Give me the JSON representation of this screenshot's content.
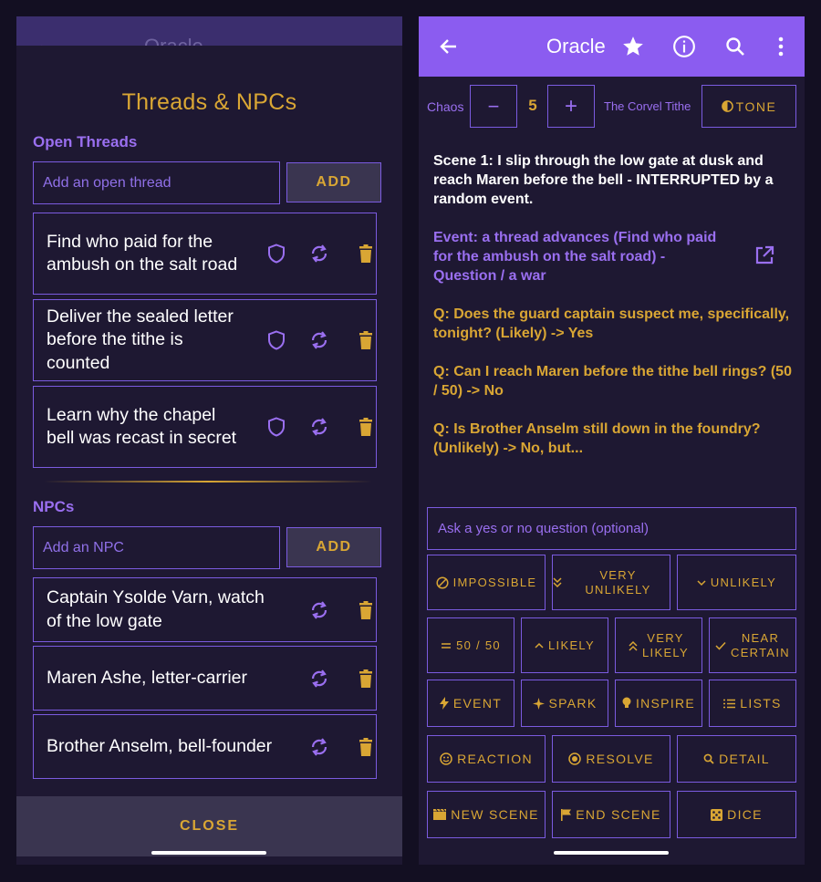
{
  "left": {
    "background_appbar": {
      "title": "Oracle"
    },
    "dialog": {
      "title": "Threads & NPCs",
      "threads_label": "Open Threads",
      "thread_input_placeholder": "Add an open thread",
      "add_label": "ADD",
      "threads": [
        {
          "text": "Find who paid for the ambush on the salt road"
        },
        {
          "text": "Deliver the sealed letter before the tithe is counted"
        },
        {
          "text": "Learn why the chapel bell was recast in secret"
        }
      ],
      "npcs_label": "NPCs",
      "npc_input_placeholder": "Add an NPC",
      "npcs": [
        {
          "text": "Captain Ysolde Varn, watch of the low gate"
        },
        {
          "text": "Maren Ashe, letter-carrier"
        },
        {
          "text": "Brother Anselm, bell-founder"
        }
      ],
      "close_label": "CLOSE"
    }
  },
  "right": {
    "appbar": {
      "title": "Oracle"
    },
    "chaos": {
      "label": "Chaos",
      "value": "5",
      "minus": "−",
      "plus": "+"
    },
    "theme_label": "The Corvel Tithe",
    "tone_label": "TONE",
    "log": {
      "scene": "Scene 1: I slip through the low gate at dusk and reach Maren before the bell - INTERRUPTED by a random event.",
      "event": "Event: a thread advances (Find who paid for the ambush on the salt road) - Question / a war",
      "questions": [
        "Q: Does the guard captain suspect me, specifically, tonight? (Likely) -> Yes",
        "Q: Can I reach Maren before the tithe bell rings? (50 / 50) -> No",
        "Q: Is Brother Anselm still down in the foundry? (Unlikely) -> No, but..."
      ]
    },
    "ask_placeholder": "Ask a yes or no question (optional)",
    "odds": {
      "impossible": "IMPOSSIBLE",
      "very_unlikely": "VERY UNLIKELY",
      "unlikely": "UNLIKELY",
      "fifty": "50 / 50",
      "likely": "LIKELY",
      "very_likely_1": "VERY",
      "very_likely_2": "LIKELY",
      "near_certain_1": "NEAR",
      "near_certain_2": "CERTAIN"
    },
    "actions": {
      "event": "EVENT",
      "spark": "SPARK",
      "inspire": "INSPIRE",
      "lists": "LISTS",
      "reaction": "REACTION",
      "resolve": "RESOLVE",
      "detail": "DETAIL",
      "new_scene": "NEW SCENE",
      "end_scene": "END SCENE",
      "dice": "DICE"
    }
  },
  "colors": {
    "background": "#130f22",
    "surface": "#1e1832",
    "accent_purple": "#8b5cf0",
    "accent_gold": "#d9a634",
    "outline": "#7b5be0"
  }
}
